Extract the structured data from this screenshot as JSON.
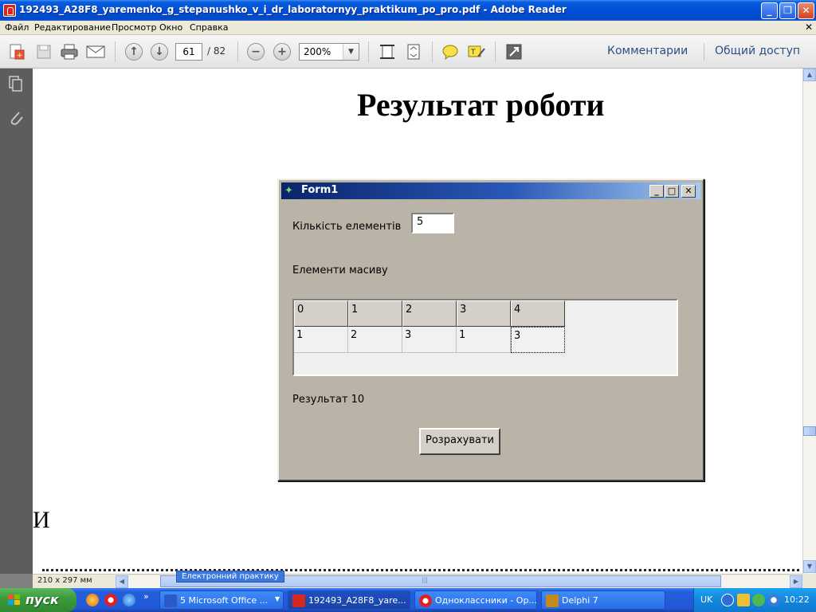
{
  "window": {
    "title": "192493_A28F8_yaremenko_g_stepanushko_v_i_dr_laboratornyy_praktikum_po_pro.pdf - Adobe Reader",
    "minimize": "_",
    "restore": "❐",
    "close": "✕"
  },
  "menu": {
    "items": [
      "Файл",
      "Редактирование",
      "Просмотр",
      "Окно",
      "Справка"
    ],
    "close_glyph": "✕"
  },
  "toolbar": {
    "page_current": "61",
    "page_total": "/ 82",
    "zoom": "200%",
    "comments_link": "Комментарии",
    "share_link": "Общий доступ"
  },
  "document": {
    "heading": "Результат роботи",
    "fragment_letter": "И"
  },
  "form1": {
    "title": "Form1",
    "count_label": "Кількість елементів",
    "count_value": "5",
    "elements_label": "Елементи масиву",
    "grid_header": [
      "0",
      "1",
      "2",
      "3",
      "4"
    ],
    "grid_values": [
      "1",
      "2",
      "3",
      "1",
      "3"
    ],
    "result_text": "Результат 10",
    "calc_button": "Розрахувати"
  },
  "status": {
    "page_size": "210 x 297 мм",
    "tooltip": "Електронний практику"
  },
  "taskbar": {
    "start": "пуск",
    "overflow": "»",
    "tasks": [
      {
        "label": "5 Microsoft Office ...",
        "color": "#2b5ac8"
      },
      {
        "label": "192493_A28F8_yare...",
        "color": "#d7281f"
      },
      {
        "label": "Одноклассники - Op...",
        "color": "#e02020"
      },
      {
        "label": "Delphi 7",
        "color": "#c48a1c"
      }
    ],
    "lang": "UK",
    "clock": "10:22"
  }
}
